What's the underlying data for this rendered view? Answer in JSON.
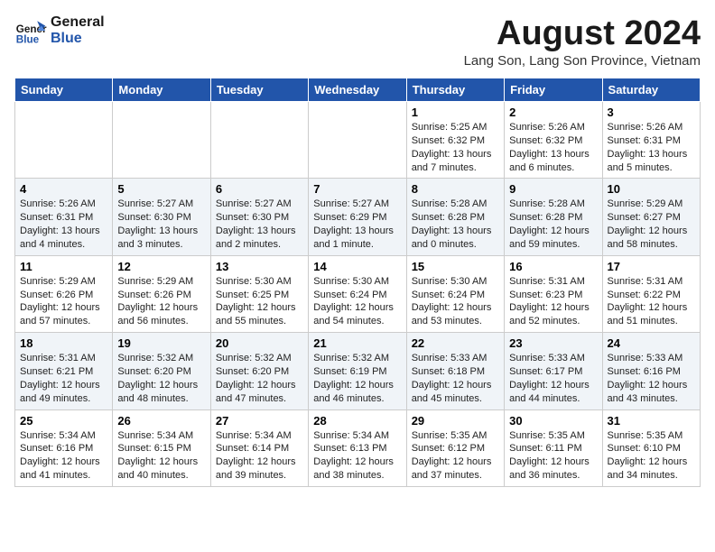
{
  "logo": {
    "line1": "General",
    "line2": "Blue"
  },
  "title": {
    "month_year": "August 2024",
    "location": "Lang Son, Lang Son Province, Vietnam"
  },
  "days_of_week": [
    "Sunday",
    "Monday",
    "Tuesday",
    "Wednesday",
    "Thursday",
    "Friday",
    "Saturday"
  ],
  "weeks": [
    [
      {
        "day": "",
        "info": ""
      },
      {
        "day": "",
        "info": ""
      },
      {
        "day": "",
        "info": ""
      },
      {
        "day": "",
        "info": ""
      },
      {
        "day": "1",
        "info": "Sunrise: 5:25 AM\nSunset: 6:32 PM\nDaylight: 13 hours\nand 7 minutes."
      },
      {
        "day": "2",
        "info": "Sunrise: 5:26 AM\nSunset: 6:32 PM\nDaylight: 13 hours\nand 6 minutes."
      },
      {
        "day": "3",
        "info": "Sunrise: 5:26 AM\nSunset: 6:31 PM\nDaylight: 13 hours\nand 5 minutes."
      }
    ],
    [
      {
        "day": "4",
        "info": "Sunrise: 5:26 AM\nSunset: 6:31 PM\nDaylight: 13 hours\nand 4 minutes."
      },
      {
        "day": "5",
        "info": "Sunrise: 5:27 AM\nSunset: 6:30 PM\nDaylight: 13 hours\nand 3 minutes."
      },
      {
        "day": "6",
        "info": "Sunrise: 5:27 AM\nSunset: 6:30 PM\nDaylight: 13 hours\nand 2 minutes."
      },
      {
        "day": "7",
        "info": "Sunrise: 5:27 AM\nSunset: 6:29 PM\nDaylight: 13 hours\nand 1 minute."
      },
      {
        "day": "8",
        "info": "Sunrise: 5:28 AM\nSunset: 6:28 PM\nDaylight: 13 hours\nand 0 minutes."
      },
      {
        "day": "9",
        "info": "Sunrise: 5:28 AM\nSunset: 6:28 PM\nDaylight: 12 hours\nand 59 minutes."
      },
      {
        "day": "10",
        "info": "Sunrise: 5:29 AM\nSunset: 6:27 PM\nDaylight: 12 hours\nand 58 minutes."
      }
    ],
    [
      {
        "day": "11",
        "info": "Sunrise: 5:29 AM\nSunset: 6:26 PM\nDaylight: 12 hours\nand 57 minutes."
      },
      {
        "day": "12",
        "info": "Sunrise: 5:29 AM\nSunset: 6:26 PM\nDaylight: 12 hours\nand 56 minutes."
      },
      {
        "day": "13",
        "info": "Sunrise: 5:30 AM\nSunset: 6:25 PM\nDaylight: 12 hours\nand 55 minutes."
      },
      {
        "day": "14",
        "info": "Sunrise: 5:30 AM\nSunset: 6:24 PM\nDaylight: 12 hours\nand 54 minutes."
      },
      {
        "day": "15",
        "info": "Sunrise: 5:30 AM\nSunset: 6:24 PM\nDaylight: 12 hours\nand 53 minutes."
      },
      {
        "day": "16",
        "info": "Sunrise: 5:31 AM\nSunset: 6:23 PM\nDaylight: 12 hours\nand 52 minutes."
      },
      {
        "day": "17",
        "info": "Sunrise: 5:31 AM\nSunset: 6:22 PM\nDaylight: 12 hours\nand 51 minutes."
      }
    ],
    [
      {
        "day": "18",
        "info": "Sunrise: 5:31 AM\nSunset: 6:21 PM\nDaylight: 12 hours\nand 49 minutes."
      },
      {
        "day": "19",
        "info": "Sunrise: 5:32 AM\nSunset: 6:20 PM\nDaylight: 12 hours\nand 48 minutes."
      },
      {
        "day": "20",
        "info": "Sunrise: 5:32 AM\nSunset: 6:20 PM\nDaylight: 12 hours\nand 47 minutes."
      },
      {
        "day": "21",
        "info": "Sunrise: 5:32 AM\nSunset: 6:19 PM\nDaylight: 12 hours\nand 46 minutes."
      },
      {
        "day": "22",
        "info": "Sunrise: 5:33 AM\nSunset: 6:18 PM\nDaylight: 12 hours\nand 45 minutes."
      },
      {
        "day": "23",
        "info": "Sunrise: 5:33 AM\nSunset: 6:17 PM\nDaylight: 12 hours\nand 44 minutes."
      },
      {
        "day": "24",
        "info": "Sunrise: 5:33 AM\nSunset: 6:16 PM\nDaylight: 12 hours\nand 43 minutes."
      }
    ],
    [
      {
        "day": "25",
        "info": "Sunrise: 5:34 AM\nSunset: 6:16 PM\nDaylight: 12 hours\nand 41 minutes."
      },
      {
        "day": "26",
        "info": "Sunrise: 5:34 AM\nSunset: 6:15 PM\nDaylight: 12 hours\nand 40 minutes."
      },
      {
        "day": "27",
        "info": "Sunrise: 5:34 AM\nSunset: 6:14 PM\nDaylight: 12 hours\nand 39 minutes."
      },
      {
        "day": "28",
        "info": "Sunrise: 5:34 AM\nSunset: 6:13 PM\nDaylight: 12 hours\nand 38 minutes."
      },
      {
        "day": "29",
        "info": "Sunrise: 5:35 AM\nSunset: 6:12 PM\nDaylight: 12 hours\nand 37 minutes."
      },
      {
        "day": "30",
        "info": "Sunrise: 5:35 AM\nSunset: 6:11 PM\nDaylight: 12 hours\nand 36 minutes."
      },
      {
        "day": "31",
        "info": "Sunrise: 5:35 AM\nSunset: 6:10 PM\nDaylight: 12 hours\nand 34 minutes."
      }
    ]
  ]
}
